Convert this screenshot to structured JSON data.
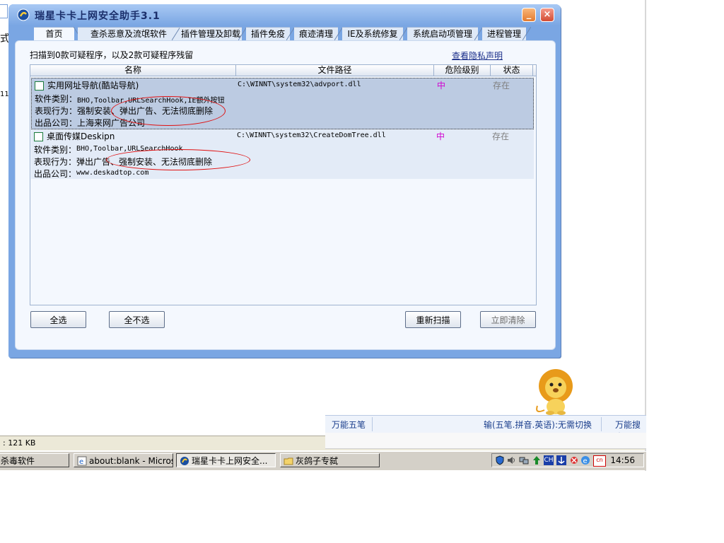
{
  "window": {
    "title": "瑞星卡卡上网安全助手3.1",
    "minimize_glyph": "_",
    "close_glyph": "×"
  },
  "tabs": [
    {
      "label": "首页"
    },
    {
      "label": "查杀恶意及流氓软件"
    },
    {
      "label": "插件管理及卸载"
    },
    {
      "label": "插件免疫"
    },
    {
      "label": "痕迹清理"
    },
    {
      "label": "IE及系统修复"
    },
    {
      "label": "系统启动项管理"
    },
    {
      "label": "进程管理"
    }
  ],
  "scan_summary": "扫描到0款可疑程序，以及2款可疑程序残留",
  "privacy_link": "查看隐私声明",
  "table": {
    "columns": [
      "名称",
      "文件路径",
      "危险级别",
      "状态"
    ],
    "rows": [
      {
        "name": "实用网址导航(酷站导航)",
        "path": "C:\\WINNT\\system32\\advport.dll",
        "danger": "中",
        "status": "存在",
        "type_label": "软件类别：",
        "type_value": "BHO,Toolbar,URLSearchHook,IE额外按钮",
        "behavior_label": "表现行为：",
        "behavior_value": "强制安装、弹出广告、无法彻底删除",
        "company_label": "出品公司：",
        "company_value": "上海来网广告公司"
      },
      {
        "name": "桌面传媒Deskipn",
        "path": "C:\\WINNT\\system32\\CreateDomTree.dll",
        "danger": "中",
        "status": "存在",
        "type_label": "软件类别：",
        "type_value": "BHO,Toolbar,URLSearchHook",
        "behavior_label": "表现行为：",
        "behavior_value": "弹出广告、强制安装、无法彻底删除",
        "company_label": "出品公司：",
        "company_value": "www.deskadtop.com"
      }
    ]
  },
  "buttons": {
    "select_all": "全选",
    "select_none": "全不选",
    "rescan": "重新扫描",
    "clean_now": "立即清除"
  },
  "background": {
    "fragment_1": "式",
    "fragment_2": "11",
    "statusbar_text": ": 121 KB",
    "ime_left": "万能五笔",
    "ime_mid": "输(五笔.拼音.英语):无需切换",
    "ime_right": "万能搜索"
  },
  "taskbar": {
    "items": [
      {
        "label": "杀毒软件"
      },
      {
        "label": "about:blank - Microsof..."
      },
      {
        "label": "瑞星卡卡上网安全..."
      },
      {
        "label": "灰鸽子专弑"
      }
    ],
    "tray_icons": [
      "shield-icon",
      "speaker-icon",
      "network-icon",
      "arrow-up-icon",
      "ime-ch-icon",
      "anchor-icon",
      "security-icon",
      "ie-icon",
      "cn-icon"
    ],
    "ime_code": "CH",
    "cn_label": "cn",
    "clock": "14:56"
  },
  "colors": {
    "window_frame": "#7aa6e3",
    "danger": "#d000d0",
    "status_gray": "#808080",
    "highlight_ellipse": "#e01010"
  }
}
